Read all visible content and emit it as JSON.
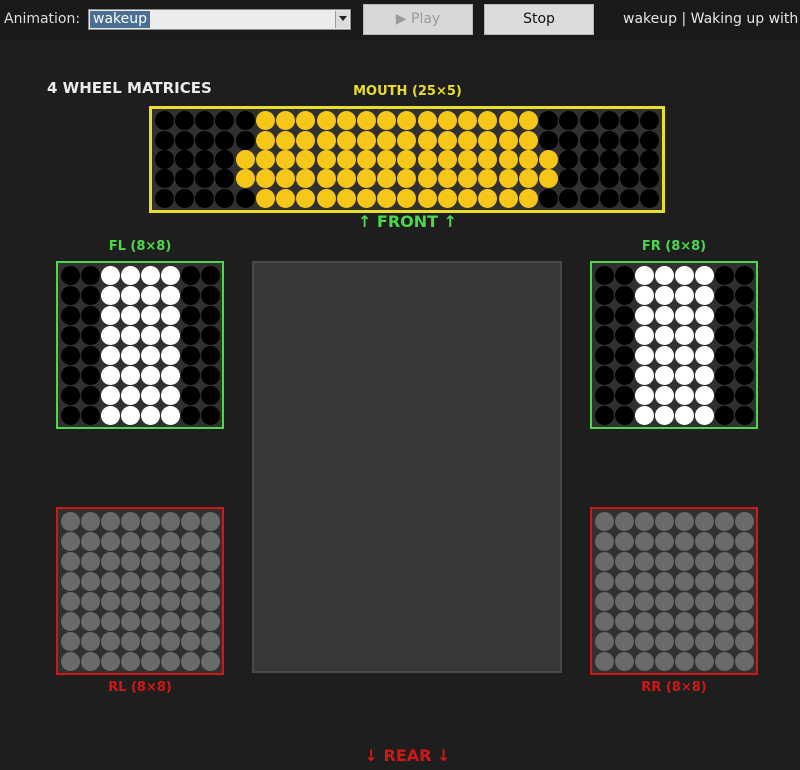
{
  "toolbar": {
    "animation_label": "Animation:",
    "selected_animation": "wakeup",
    "play_label": "▶ Play",
    "stop_label": "Stop",
    "status": "wakeup | Waking up with e"
  },
  "heading": "4 WHEEL MATRICES",
  "mouth": {
    "title": "MOUTH (25×5)",
    "color": "#f6c619",
    "border": "#e9de2a",
    "rows": [
      "0000011111111111111000000",
      "0000011111111111111000000",
      "0000111111111111111100000",
      "0000111111111111111100000",
      "0000011111111111111000000"
    ]
  },
  "front_label": "↑ FRONT ↑",
  "rear_label": "↓ REAR ↓",
  "wheels": {
    "fl": {
      "title": "FL (8×8)",
      "border": "#4cd84c",
      "label_color": "#4cd84c",
      "rows": [
        "00111100",
        "00111100",
        "00111100",
        "00111100",
        "00111100",
        "00111100",
        "00111100",
        "00111100"
      ]
    },
    "fr": {
      "title": "FR (8×8)",
      "border": "#4cd84c",
      "label_color": "#4cd84c",
      "rows": [
        "00111100",
        "00111100",
        "00111100",
        "00111100",
        "00111100",
        "00111100",
        "00111100",
        "00111100"
      ]
    },
    "rl": {
      "title": "RL (8×8)",
      "border": "#d01818",
      "label_color": "#d01818",
      "rows": [
        "22222222",
        "22222222",
        "22222222",
        "22222222",
        "22222222",
        "22222222",
        "22222222",
        "22222222"
      ]
    },
    "rr": {
      "title": "RR (8×8)",
      "border": "#d01818",
      "label_color": "#d01818",
      "rows": [
        "22222222",
        "22222222",
        "22222222",
        "22222222",
        "22222222",
        "22222222",
        "22222222",
        "22222222"
      ]
    }
  },
  "colors": {
    "front": "#4cd84c",
    "rear": "#d01818",
    "mouth_title": "#e9de2a"
  }
}
